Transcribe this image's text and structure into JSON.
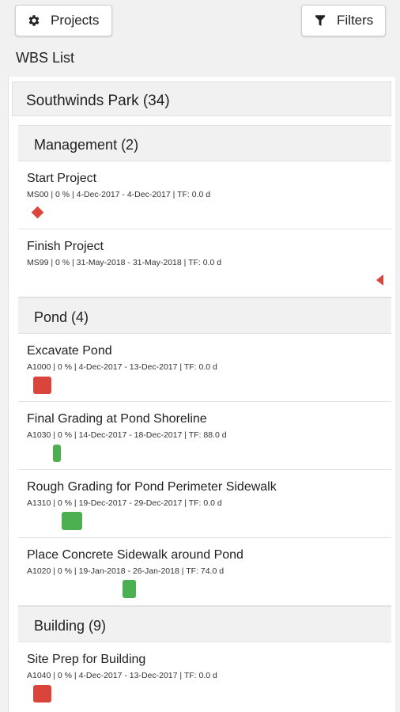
{
  "toolbar": {
    "projects_label": "Projects",
    "projects_icon": "gear-icon",
    "filters_label": "Filters",
    "filters_icon": "filter-icon"
  },
  "wbs_title": "WBS List",
  "project": {
    "title": "Southwinds Park (34)"
  },
  "groups": [
    {
      "title": "Management (2)"
    },
    {
      "title": "Pond (4)"
    },
    {
      "title": "Building (9)"
    }
  ],
  "items": [
    {
      "name": "Start Project",
      "meta": "MS00 | 0 % | 4-Dec-2017 - 4-Dec-2017 | TF: 0.0 d",
      "marker": "milestone-diamond",
      "color": "#d9443b"
    },
    {
      "name": "Finish Project",
      "meta": "MS99 | 0 % | 31-May-2018 - 31-May-2018 | TF: 0.0 d",
      "marker": "milestone-arrow",
      "color": "#d9443b"
    },
    {
      "name": "Excavate Pond",
      "meta": "A1000 | 0 % | 4-Dec-2017 - 13-Dec-2017 | TF: 0.0 d",
      "marker": "bar",
      "color": "#d9443b"
    },
    {
      "name": "Final Grading at Pond Shoreline",
      "meta": "A1030 | 0 % | 14-Dec-2017 - 18-Dec-2017 | TF: 88.0 d",
      "marker": "bar",
      "color": "#4cb050"
    },
    {
      "name": "Rough Grading for Pond Perimeter Sidewalk",
      "meta": "A1310 | 0 % | 19-Dec-2017 - 29-Dec-2017 | TF: 0.0 d",
      "marker": "bar",
      "color": "#4cb050"
    },
    {
      "name": "Place Concrete Sidewalk around Pond",
      "meta": "A1020 | 0 % | 19-Jan-2018 - 26-Jan-2018 | TF: 74.0 d",
      "marker": "bar",
      "color": "#4cb050"
    },
    {
      "name": "Site Prep for Building",
      "meta": "A1040 | 0 % | 4-Dec-2017 - 13-Dec-2017 | TF: 0.0 d",
      "marker": "bar",
      "color": "#d9443b"
    }
  ]
}
